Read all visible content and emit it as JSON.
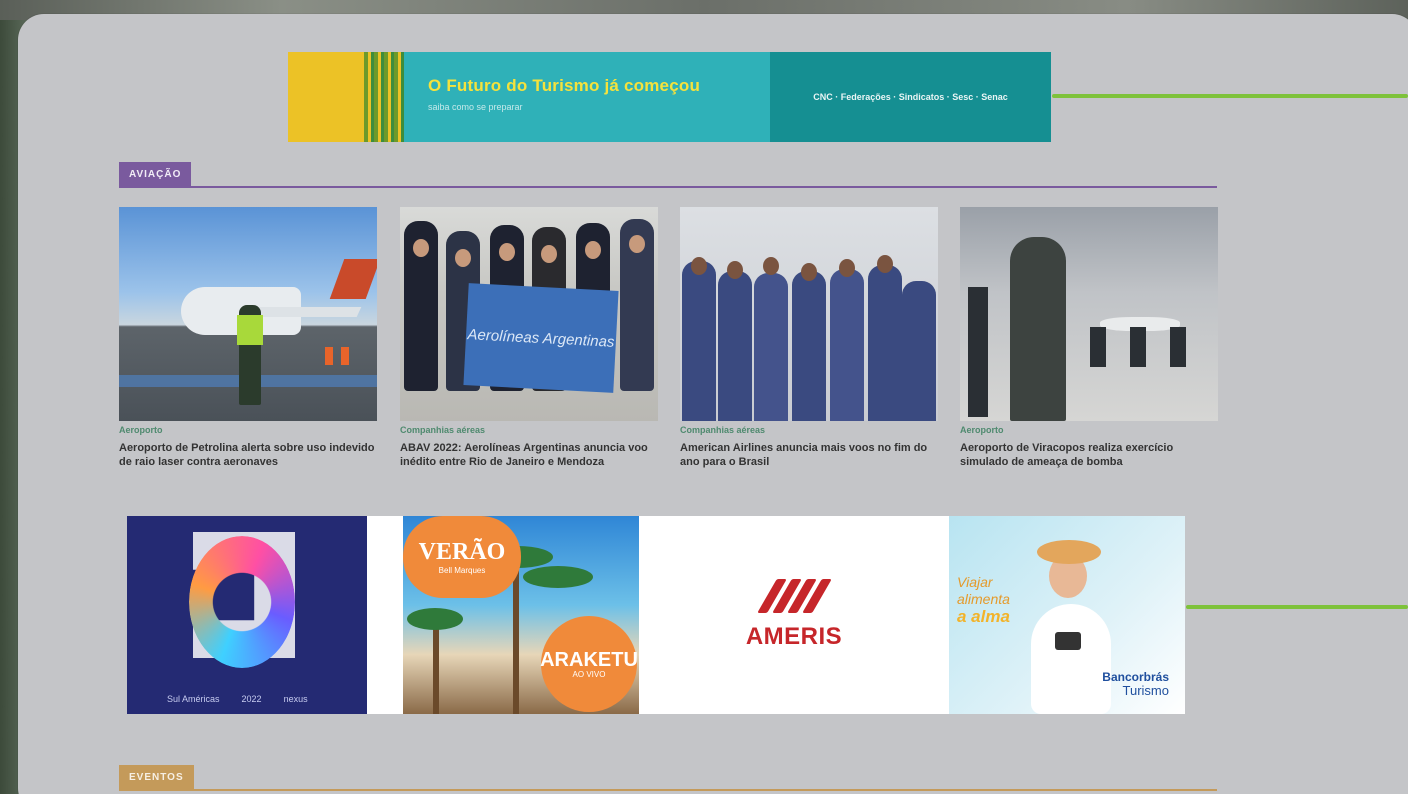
{
  "banner": {
    "headline": "O Futuro do Turismo já começou",
    "subline": "saiba como se preparar",
    "partners": "CNC · Federações · Sindicatos · Sesc · Senac"
  },
  "section": {
    "label": "AVIAÇÃO"
  },
  "articles": [
    {
      "category": "Aeroporto",
      "title": "Aeroporto de Petrolina alerta sobre uso indevido de raio laser contra aeronaves"
    },
    {
      "category": "Companhias aéreas",
      "title": "ABAV 2022: Aerolíneas Argentinas anuncia voo inédito entre Rio de Janeiro e Mendoza"
    },
    {
      "category": "Companhias aéreas",
      "title": "American Airlines anuncia mais voos no fim do ano para o Brasil"
    },
    {
      "category": "Aeroporto",
      "title": "Aeroporto de Viracopos realiza exercício simulado de ameaça de bomba"
    }
  ],
  "photo2": {
    "flag_text": "Aerolíneas Argentinas"
  },
  "ads": {
    "ad1": {
      "footer_left": "Sul Américas",
      "year": "2022",
      "brand": "nexus"
    },
    "ad2": {
      "top": "VERÃO",
      "top_sub": "Bell Marques",
      "bottom": "ARAKETU",
      "bottom_sub": "AO VIVO"
    },
    "ad3": {
      "brand": "AMERIS"
    },
    "ad4": {
      "line1": "Viajar",
      "line2": "alimenta",
      "line3": "a alma",
      "logo1": "Bancorbrás",
      "logo2": "Turismo"
    }
  },
  "section2": {
    "label": "EVENTOS"
  },
  "colors": {
    "panel": "#c4c5c8",
    "aviation_accent": "#7a5a9e",
    "events_accent": "#c49a5a",
    "green_line": "#7ec23b",
    "banner_yellow": "#ecc226",
    "banner_teal": "#2fb1b8",
    "banner_dark_teal": "#158f92",
    "ameris_red": "#c6262a"
  }
}
